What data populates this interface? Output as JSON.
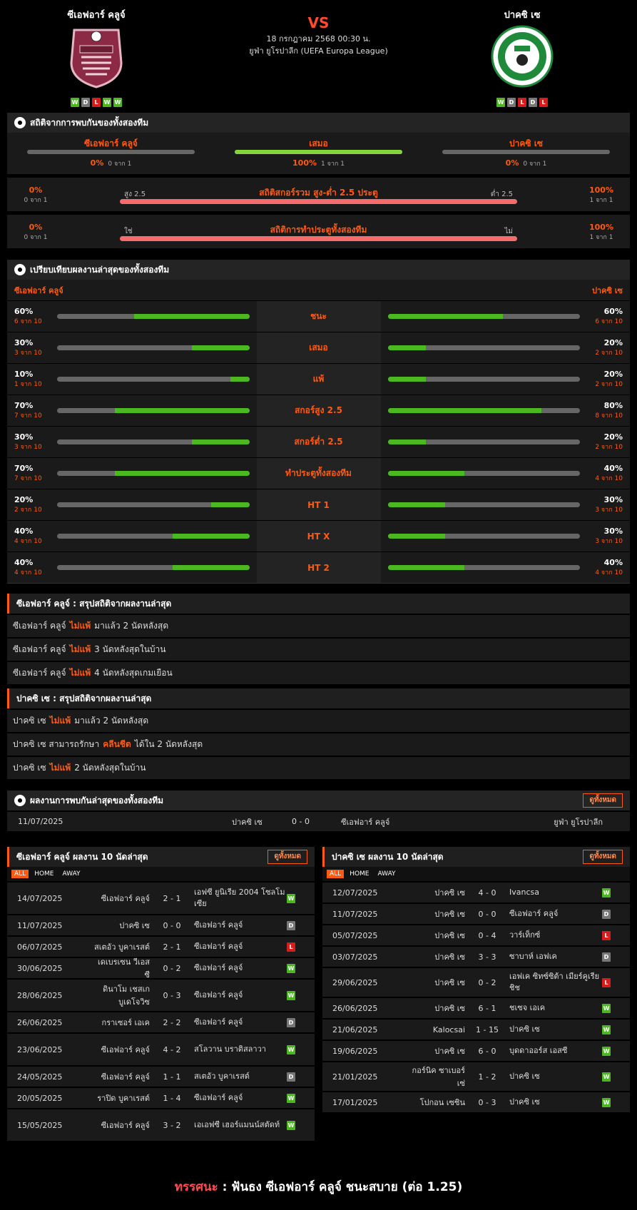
{
  "match": {
    "home": "ซีเอฟอาร์ คลูจ์",
    "away": "ปาคซิ เซ",
    "vs": "VS",
    "datetime": "18 กรกฎาคม 2568 00:30 น.",
    "competition": "ยูฟ่า ยูโรปาลีก (UEFA Europa League)",
    "home_form": [
      "W",
      "D",
      "L",
      "W",
      "W"
    ],
    "away_form": [
      "W",
      "D",
      "L",
      "D",
      "L"
    ]
  },
  "h2h": {
    "title": "สถิติจากการพบกันของทั้งสองทีม",
    "cols": [
      {
        "label": "ซีเอฟอาร์ คลูจ์",
        "pct": "0%",
        "count": "0 จาก 1",
        "fill": 0
      },
      {
        "label": "เสมอ",
        "pct": "100%",
        "count": "1 จาก 1",
        "fill": 1
      },
      {
        "label": "ปาคซิ เซ",
        "pct": "0%",
        "count": "0 จาก 1",
        "fill": 0
      }
    ],
    "ou": {
      "title": "สถิติสกอร์รวม สูง-ต่ำ 2.5 ประตู",
      "left_label": "สูง 2.5",
      "right_label": "ต่ำ 2.5",
      "left_pct": "0%",
      "left_count": "0 จาก 1",
      "right_pct": "100%",
      "right_count": "1 จาก 1"
    },
    "bt": {
      "title": "สถิติการทำประตูทั้งสองทีม",
      "left_label": "ใช่",
      "right_label": "ไม่",
      "left_pct": "0%",
      "left_count": "0 จาก 1",
      "right_pct": "100%",
      "right_count": "1 จาก 1"
    }
  },
  "compare": {
    "title": "เปรียบเทียบผลงานล่าสุดของทั้งสองทีม",
    "home": "ซีเอฟอาร์ คลูจ์",
    "away": "ปาคซิ เซ",
    "rows": [
      {
        "label": "ชนะ",
        "hp": "60%",
        "hc": "6 จาก 10",
        "hv": 0.6,
        "ap": "60%",
        "ac": "6 จาก 10",
        "av": 0.6
      },
      {
        "label": "เสมอ",
        "hp": "30%",
        "hc": "3 จาก 10",
        "hv": 0.3,
        "ap": "20%",
        "ac": "2 จาก 10",
        "av": 0.2
      },
      {
        "label": "แพ้",
        "hp": "10%",
        "hc": "1 จาก 10",
        "hv": 0.1,
        "ap": "20%",
        "ac": "2 จาก 10",
        "av": 0.2
      },
      {
        "label": "สกอร์สูง 2.5",
        "hp": "70%",
        "hc": "7 จาก 10",
        "hv": 0.7,
        "ap": "80%",
        "ac": "8 จาก 10",
        "av": 0.8
      },
      {
        "label": "สกอร์ต่ำ 2.5",
        "hp": "30%",
        "hc": "3 จาก 10",
        "hv": 0.3,
        "ap": "20%",
        "ac": "2 จาก 10",
        "av": 0.2
      },
      {
        "label": "ทำประตูทั้งสองทีม",
        "hp": "70%",
        "hc": "7 จาก 10",
        "hv": 0.7,
        "ap": "40%",
        "ac": "4 จาก 10",
        "av": 0.4
      },
      {
        "label": "HT 1",
        "hp": "20%",
        "hc": "2 จาก 10",
        "hv": 0.2,
        "ap": "30%",
        "ac": "3 จาก 10",
        "av": 0.3
      },
      {
        "label": "HT X",
        "hp": "40%",
        "hc": "4 จาก 10",
        "hv": 0.4,
        "ap": "30%",
        "ac": "3 จาก 10",
        "av": 0.3
      },
      {
        "label": "HT 2",
        "hp": "40%",
        "hc": "4 จาก 10",
        "hv": 0.4,
        "ap": "40%",
        "ac": "4 จาก 10",
        "av": 0.4
      }
    ]
  },
  "summary_home": {
    "title": "ซีเอฟอาร์ คลูจ์ : สรุปสถิติจากผลงานล่าสุด",
    "lines": [
      {
        "a": "ซีเอฟอาร์ คลูจ์",
        "h": "ไม่แพ้",
        "b": "มาแล้ว 2 นัดหลังสุด"
      },
      {
        "a": "ซีเอฟอาร์ คลูจ์",
        "h": "ไม่แพ้",
        "b": "3 นัดหลังสุดในบ้าน"
      },
      {
        "a": "ซีเอฟอาร์ คลูจ์",
        "h": "ไม่แพ้",
        "b": "4 นัดหลังสุดเกมเยือน"
      }
    ]
  },
  "summary_away": {
    "title": "ปาคซิ เซ : สรุปสถิติจากผลงานล่าสุด",
    "lines": [
      {
        "a": "ปาคซิ เซ",
        "h": "ไม่แพ้",
        "b": "มาแล้ว 2 นัดหลังสุด"
      },
      {
        "a": "ปาคซิ เซ สามารถรักษา",
        "h": "คลีนชีต",
        "b": "ได้ใน 2 นัดหลังสุด"
      },
      {
        "a": "ปาคซิ เซ",
        "h": "ไม่แพ้",
        "b": "2 นัดหลังสุดในบ้าน"
      }
    ]
  },
  "last_h2h": {
    "title": "ผลงานการพบกันล่าสุดของทั้งสองทีม",
    "view_all": "ดูทั้งหมด",
    "rows": [
      {
        "date": "11/07/2025",
        "home": "ปาคซิ เซ",
        "score": "0 - 0",
        "away": "ซีเอฟอาร์ คลูจ์",
        "comp": "ยูฟ่า ยูโรปาลีก"
      }
    ]
  },
  "tabs": [
    "ALL",
    "HOME",
    "AWAY"
  ],
  "home_last": {
    "title": "ซีเอฟอาร์ คลูจ์ ผลงาน 10 นัดล่าสุด",
    "view_all": "ดูทั้งหมด",
    "rows": [
      {
        "date": "14/07/2025",
        "home": "ซีเอฟอาร์ คลูจ์",
        "score": "2 - 1",
        "away": "เอฟซี ยูนิเรีย 2004 โซลโมเซีย",
        "res": "W"
      },
      {
        "date": "11/07/2025",
        "home": "ปาคซิ เซ",
        "score": "0 - 0",
        "away": "ซีเอฟอาร์ คลูจ์",
        "res": "D"
      },
      {
        "date": "06/07/2025",
        "home": "สเตอัว บูคาเรสต์",
        "score": "2 - 1",
        "away": "ซีเอฟอาร์ คลูจ์",
        "res": "L"
      },
      {
        "date": "30/06/2025",
        "home": "เดเบรเซน วีเอสซี",
        "score": "0 - 2",
        "away": "ซีเอฟอาร์ คลูจ์",
        "res": "W"
      },
      {
        "date": "28/06/2025",
        "home": "ดินาโม เชสเก บูเดโจวิซ",
        "score": "0 - 3",
        "away": "ซีเอฟอาร์ คลูจ์",
        "res": "W"
      },
      {
        "date": "26/06/2025",
        "home": "กราเซอร์ เอเค",
        "score": "2 - 2",
        "away": "ซีเอฟอาร์ คลูจ์",
        "res": "D"
      },
      {
        "date": "23/06/2025",
        "home": "ซีเอฟอาร์ คลูจ์",
        "score": "4 - 2",
        "away": "สโลวาน บราติสลาวา",
        "res": "W"
      },
      {
        "date": "24/05/2025",
        "home": "ซีเอฟอาร์ คลูจ์",
        "score": "1 - 1",
        "away": "สเตอัว บูคาเรสต์",
        "res": "D"
      },
      {
        "date": "20/05/2025",
        "home": "ราปิด บูคาเรสต์",
        "score": "1 - 4",
        "away": "ซีเอฟอาร์ คลูจ์",
        "res": "W"
      },
      {
        "date": "15/05/2025",
        "home": "ซีเอฟอาร์ คลูจ์",
        "score": "3 - 2",
        "away": "เอเอฟซี เฮอร์แมนน์สตัดท์",
        "res": "W"
      }
    ]
  },
  "away_last": {
    "title": "ปาคซิ เซ ผลงาน 10 นัดล่าสุด",
    "view_all": "ดูทั้งหมด",
    "rows": [
      {
        "date": "12/07/2025",
        "home": "ปาคซิ เซ",
        "score": "4 - 0",
        "away": "Ivancsa",
        "res": "W"
      },
      {
        "date": "11/07/2025",
        "home": "ปาคซิ เซ",
        "score": "0 - 0",
        "away": "ซีเอฟอาร์ คลูจ์",
        "res": "D"
      },
      {
        "date": "05/07/2025",
        "home": "ปาคซิ เซ",
        "score": "0 - 4",
        "away": "วาร์เท็กซ์",
        "res": "L"
      },
      {
        "date": "03/07/2025",
        "home": "ปาคซิ เซ",
        "score": "3 - 3",
        "away": "ซาบาห์ เอฟเค",
        "res": "D"
      },
      {
        "date": "29/06/2025",
        "home": "ปาคซิ เซ",
        "score": "0 - 2",
        "away": "เอฟเค ซิทซ์ซิต้า เมียร์คูเรีย ชิช",
        "res": "L"
      },
      {
        "date": "26/06/2025",
        "home": "ปาคซิ เซ",
        "score": "6 - 1",
        "away": "ชเซจ เอเค",
        "res": "W"
      },
      {
        "date": "21/06/2025",
        "home": "Kalocsai",
        "score": "1 - 15",
        "away": "ปาคซิ เซ",
        "res": "W"
      },
      {
        "date": "19/06/2025",
        "home": "ปาคซิ เซ",
        "score": "6 - 0",
        "away": "บุดดาออร์ส เอสซี",
        "res": "W"
      },
      {
        "date": "21/01/2025",
        "home": "กอร์นิค ซาเบอร์เซ่",
        "score": "1 - 2",
        "away": "ปาคซิ เซ",
        "res": "W"
      },
      {
        "date": "17/01/2025",
        "home": "โปกอน เซซิน",
        "score": "0 - 3",
        "away": "ปาคซิ เซ",
        "res": "W"
      }
    ]
  },
  "tip": {
    "label": "ทรรศนะ",
    "sep": ":",
    "text": "ฟันธง ซีเอฟอาร์ คลูจ์ ชนะสบาย (ต่อ 1.25)"
  },
  "colors": {
    "accent": "#ff5a14",
    "win": "#4bb821",
    "draw": "#777777",
    "loss": "#d81c1c",
    "bar": "#f46d6d"
  }
}
